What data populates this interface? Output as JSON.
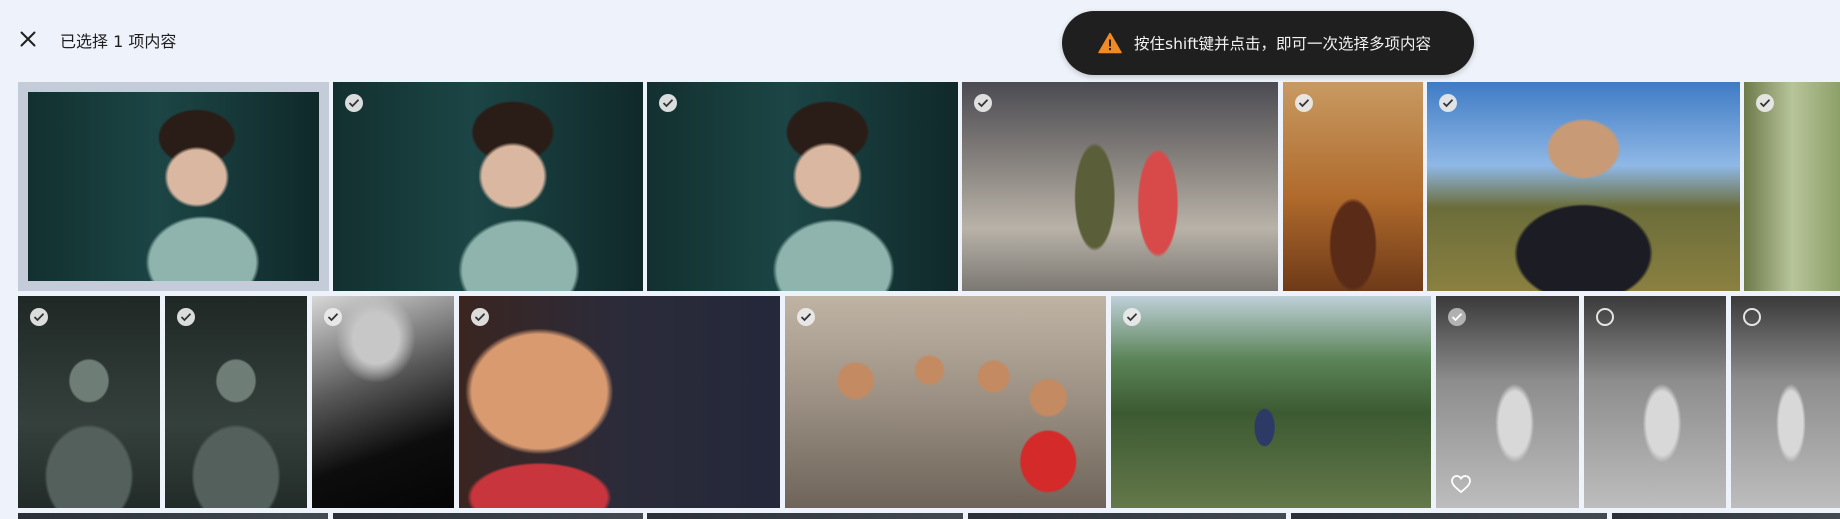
{
  "header": {
    "selection_text": "已选择 1 项内容",
    "close_icon": "close-icon"
  },
  "toast": {
    "icon": "warning-icon",
    "message": "按住shift键并点击，即可一次选择多项内容",
    "background": "#1f1f1f",
    "icon_color": "#f08a24"
  },
  "photos": [
    {
      "name": "photo-boy-teal-1",
      "state": "selected"
    },
    {
      "name": "photo-boy-teal-2",
      "state": "checked"
    },
    {
      "name": "photo-boy-teal-3",
      "state": "checked"
    },
    {
      "name": "photo-two-kids",
      "state": "checked"
    },
    {
      "name": "photo-child-orange",
      "state": "checked"
    },
    {
      "name": "photo-boy-horses",
      "state": "checked"
    },
    {
      "name": "photo-blurred-green",
      "state": "checked"
    },
    {
      "name": "photo-tribal-child-1",
      "state": "checked"
    },
    {
      "name": "photo-tribal-child-2",
      "state": "checked"
    },
    {
      "name": "photo-arch-silhouette",
      "state": "checked"
    },
    {
      "name": "photo-child-face",
      "state": "checked"
    },
    {
      "name": "photo-group-kids",
      "state": "checked"
    },
    {
      "name": "photo-boy-grass",
      "state": "checked"
    },
    {
      "name": "photo-baby-feet-1",
      "state": "checked-light",
      "favorite_icon": "heart-outline-icon"
    },
    {
      "name": "photo-baby-feet-2",
      "state": "unchecked"
    },
    {
      "name": "photo-baby-feet-3",
      "state": "unchecked"
    }
  ],
  "colors": {
    "background": "#eef2fa",
    "selection_frame": "#c4cbd9"
  }
}
